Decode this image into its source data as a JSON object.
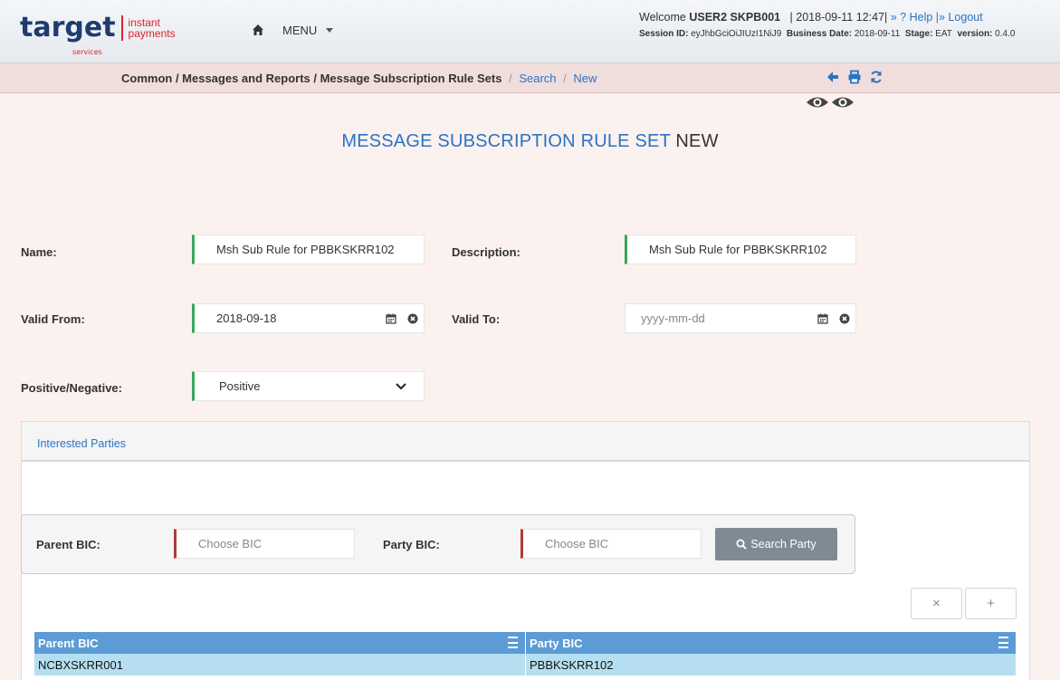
{
  "header": {
    "logo_main": "target",
    "logo_sub": "services",
    "logo_instant": "instant",
    "logo_payments": "payments",
    "menu_label": "MENU",
    "welcome_text": "Welcome",
    "user": "USER2 SKPB001",
    "datetime": "| 2018-09-11 12:47|",
    "help_label": "» ? Help",
    "logout_label": "|» Logout",
    "session_label": "Session ID:",
    "session_value": "eyJhbGciOiJIUzI1NiJ9",
    "business_date_label": "Business Date:",
    "business_date_value": "2018-09-11",
    "stage_label": "Stage:",
    "stage_value": "EAT",
    "version_label": "version:",
    "version_value": "0.4.0"
  },
  "breadcrumb": {
    "path": "Common / Messages and Reports / Message Subscription Rule Sets",
    "sep": "/",
    "search": "Search",
    "new": "New"
  },
  "page": {
    "title_main": "MESSAGE SUBSCRIPTION RULE SET",
    "title_sub": "NEW"
  },
  "form": {
    "name_label": "Name:",
    "name_value": "Msh Sub Rule for PBBKSKRR102",
    "description_label": "Description:",
    "description_value": "Msh Sub Rule for PBBKSKRR102",
    "valid_from_label": "Valid From:",
    "valid_from_value": "2018-09-18",
    "valid_to_label": "Valid To:",
    "valid_to_placeholder": "yyyy-mm-dd",
    "posneg_label": "Positive/Negative:",
    "posneg_value": "Positive"
  },
  "parties": {
    "tab_label": "Interested Parties",
    "parent_bic_label": "Parent BIC:",
    "parent_bic_placeholder": "Choose BIC",
    "party_bic_label": "Party BIC:",
    "party_bic_placeholder": "Choose BIC",
    "search_button": "Search Party",
    "remove_symbol": "×",
    "add_symbol": "+",
    "columns": [
      "Parent BIC",
      "Party BIC"
    ],
    "rows": [
      [
        "NCBXSKRR001",
        "PBBKSKRR102"
      ]
    ]
  },
  "colors": {
    "accent_blue": "#2b73c4",
    "required_green": "#3aa65a",
    "required_red": "#b33a3a",
    "grid_header": "#5c9bd6",
    "grid_row": "#b5dff0"
  }
}
